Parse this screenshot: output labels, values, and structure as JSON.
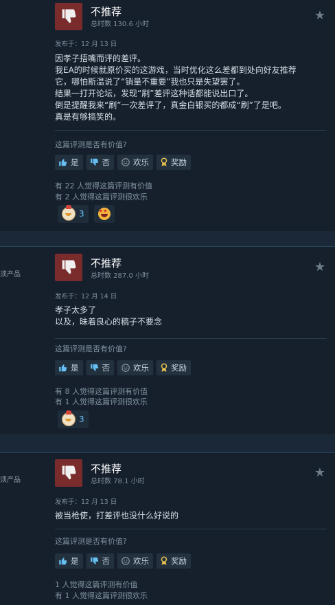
{
  "reviews": [
    {
      "side_label": "",
      "recommendation": "不推荐",
      "hours": "总时数 130.6 小时",
      "posted": "发布于：12 月 13 日",
      "body_lines": [
        "因孝子捂嘴而评的差评。",
        "我EA的时候就原价买的这游戏，当时优化这么差都到处向好友推荐",
        "它，哪怕斯温说了“销量不重要”我也只是失望罢了。",
        "结果一打开论坛，发现“刷”差评这种话都能说出口了。",
        "倒是提醒我来“刷”一次差评了，真金白银买的都成“刷”了是吧。",
        "真是有够搞笑的。"
      ],
      "helpful_question": "这篇评测是否有价值?",
      "buttons": {
        "yes": "是",
        "no": "否",
        "funny": "欢乐",
        "award": "奖励"
      },
      "helpful_stat": "有 22 人觉得这篇评测有价值",
      "funny_stat": "有 2 人觉得这篇评测很欢乐",
      "reactions": [
        {
          "icon": "chick-emoji",
          "count": "3"
        },
        {
          "icon": "star-eyes-emoji",
          "count": ""
        }
      ]
    },
    {
      "side_label": "须产品",
      "recommendation": "不推荐",
      "hours": "总时数 287.0 小时",
      "posted": "发布于：12 月 14 日",
      "body_lines": [
        "孝子太多了",
        "以及，昧着良心的稿子不要念"
      ],
      "helpful_question": "这篇评测是否有价值?",
      "buttons": {
        "yes": "是",
        "no": "否",
        "funny": "欢乐",
        "award": "奖励"
      },
      "helpful_stat": "有 8 人觉得这篇评测有价值",
      "funny_stat": "有 1 人觉得这篇评测很欢乐",
      "reactions": [
        {
          "icon": "chick-emoji",
          "count": "3"
        }
      ]
    },
    {
      "side_label": "须产品",
      "recommendation": "不推荐",
      "hours": "总时数 78.1 小时",
      "posted": "发布于：12 月 13 日",
      "body_lines": [
        "被当枪使，打差评也没什么好说的"
      ],
      "helpful_question": "这篇评测是否有价值?",
      "buttons": {
        "yes": "是",
        "no": "否",
        "funny": "欢乐",
        "award": "奖励"
      },
      "helpful_stat": "1 人觉得这篇评测有价值",
      "funny_stat": "有 1 人觉得这篇评测很欢乐",
      "reactions": []
    }
  ],
  "colors": {
    "background": "#1b2838",
    "card": "#16202d",
    "thumb_down": "#7a2b2b",
    "link": "#66c0f4"
  }
}
